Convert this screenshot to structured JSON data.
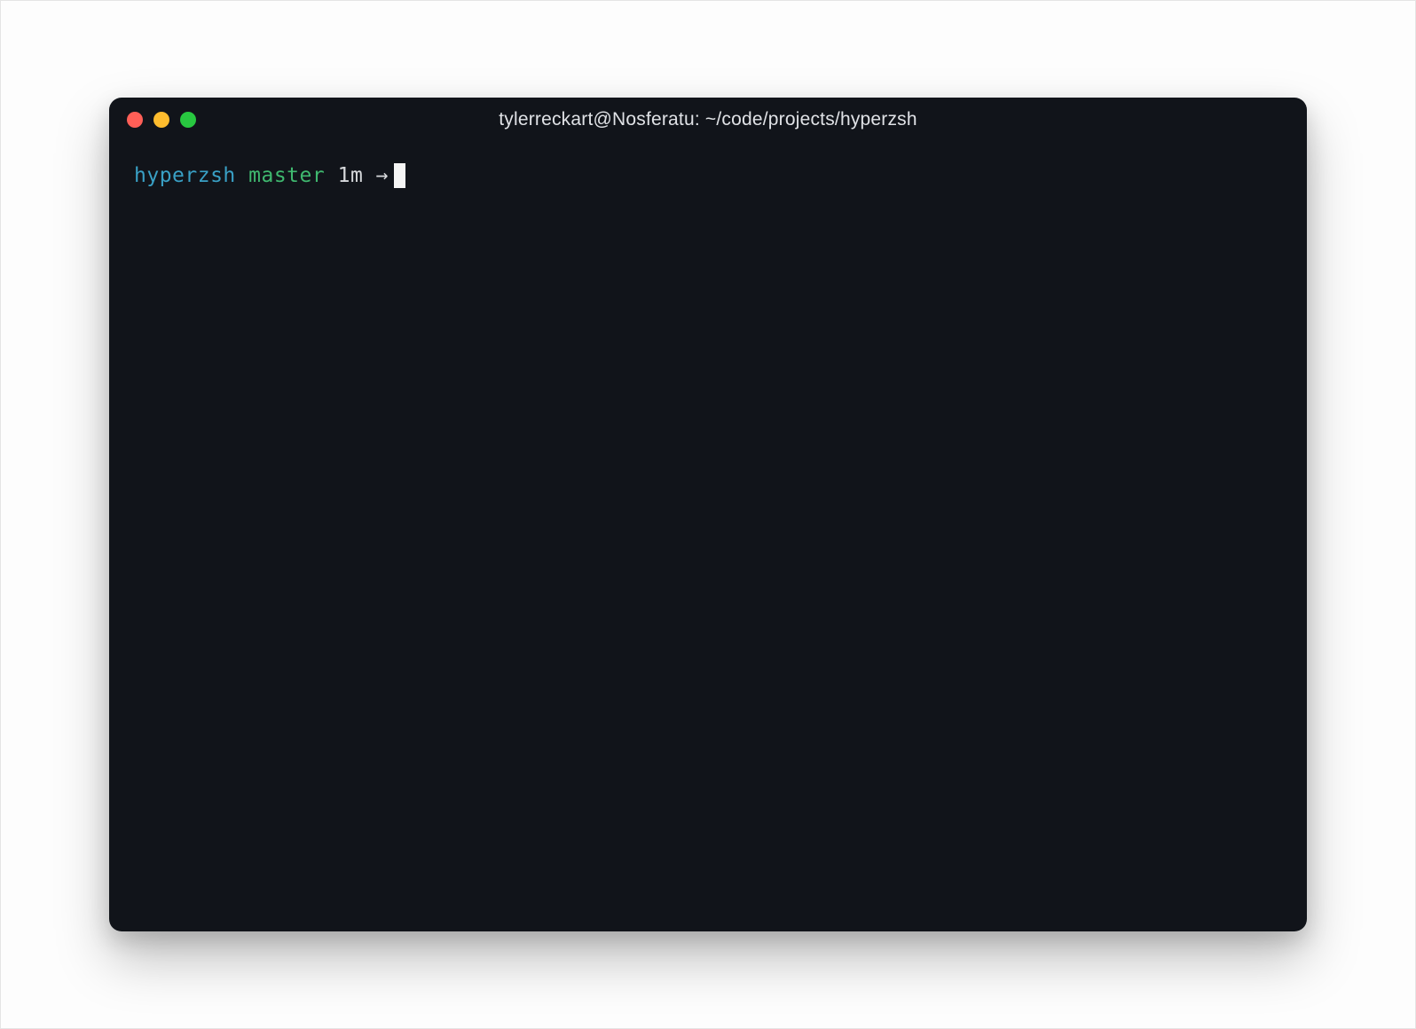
{
  "window": {
    "title": "tylerreckart@Nosferatu: ~/code/projects/hyperzsh",
    "controls": {
      "close": "close",
      "minimize": "minimize",
      "maximize": "maximize"
    }
  },
  "prompt": {
    "directory": "hyperzsh",
    "branch": "master",
    "time": "1m",
    "arrow": "→"
  },
  "colors": {
    "background": "#11141a",
    "directory": "#39a0c5",
    "branch": "#3fb86f",
    "text": "#d7d9dc",
    "close": "#ff5f57",
    "minimize": "#febc2e",
    "maximize": "#28c840"
  }
}
